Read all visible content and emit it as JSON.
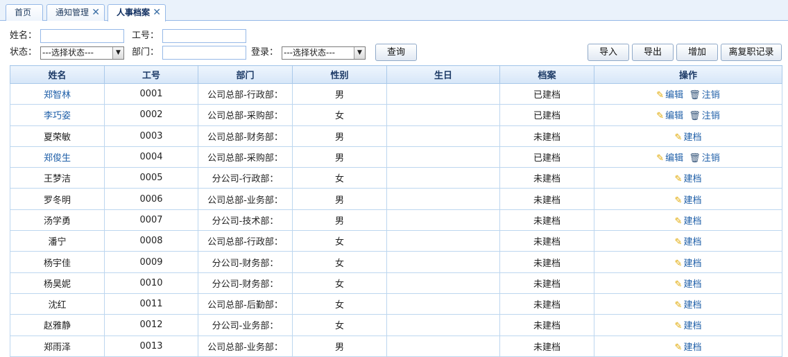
{
  "tabs": [
    {
      "label": "首页",
      "closable": false
    },
    {
      "label": "通知管理",
      "closable": true
    },
    {
      "label": "人事档案",
      "closable": true,
      "active": true
    }
  ],
  "tab_close_glyph": "✕",
  "search": {
    "name_label": "姓名：",
    "id_label": "工号：",
    "status_label": "状态：",
    "status_selected": "---选择状态---",
    "dept_label": "部门：",
    "login_label": "登录：",
    "login_selected": "---选择状态---",
    "query_button": "查询"
  },
  "actions": {
    "import": "导入",
    "export": "导出",
    "add": "增加",
    "resign_records": "离复职记录"
  },
  "table": {
    "headers": [
      "姓名",
      "工号",
      "部门",
      "性别",
      "生日",
      "档案",
      "操作"
    ],
    "op_labels": {
      "edit": "编辑",
      "cancel": "注销",
      "create": "建档"
    },
    "rows": [
      {
        "name": "郑智林",
        "id": "0001",
        "dept": "公司总部-行政部：",
        "gender": "男",
        "birthday": "",
        "file": "已建档",
        "link": true
      },
      {
        "name": "李巧姿",
        "id": "0002",
        "dept": "公司总部-采购部：",
        "gender": "女",
        "birthday": "",
        "file": "已建档",
        "link": true
      },
      {
        "name": "夏荣敏",
        "id": "0003",
        "dept": "公司总部-财务部：",
        "gender": "男",
        "birthday": "",
        "file": "未建档",
        "link": false
      },
      {
        "name": "郑俊生",
        "id": "0004",
        "dept": "公司总部-采购部：",
        "gender": "男",
        "birthday": "",
        "file": "已建档",
        "link": true
      },
      {
        "name": "王梦洁",
        "id": "0005",
        "dept": "分公司-行政部：",
        "gender": "女",
        "birthday": "",
        "file": "未建档",
        "link": false
      },
      {
        "name": "罗冬明",
        "id": "0006",
        "dept": "公司总部-业务部：",
        "gender": "男",
        "birthday": "",
        "file": "未建档",
        "link": false
      },
      {
        "name": "汤学勇",
        "id": "0007",
        "dept": "分公司-技术部：",
        "gender": "男",
        "birthday": "",
        "file": "未建档",
        "link": false
      },
      {
        "name": "潘宁",
        "id": "0008",
        "dept": "公司总部-行政部：",
        "gender": "女",
        "birthday": "",
        "file": "未建档",
        "link": false
      },
      {
        "name": "杨宇佳",
        "id": "0009",
        "dept": "分公司-财务部：",
        "gender": "女",
        "birthday": "",
        "file": "未建档",
        "link": false
      },
      {
        "name": "杨昊妮",
        "id": "0010",
        "dept": "分公司-财务部：",
        "gender": "女",
        "birthday": "",
        "file": "未建档",
        "link": false
      },
      {
        "name": "沈红",
        "id": "0011",
        "dept": "公司总部-后勤部：",
        "gender": "女",
        "birthday": "",
        "file": "未建档",
        "link": false
      },
      {
        "name": "赵雅静",
        "id": "0012",
        "dept": "分公司-业务部：",
        "gender": "女",
        "birthday": "",
        "file": "未建档",
        "link": false
      },
      {
        "name": "郑雨泽",
        "id": "0013",
        "dept": "公司总部-业务部：",
        "gender": "男",
        "birthday": "",
        "file": "未建档",
        "link": false
      }
    ]
  },
  "colors": {
    "link": "#1f5fa8",
    "header_bg": "#d6e6f8",
    "border": "#95b8e7"
  },
  "icons": {
    "edit": "pencil-icon",
    "cancel": "trash-icon",
    "select_arrow": "chevron-down-icon",
    "tab_close": "close-icon"
  }
}
